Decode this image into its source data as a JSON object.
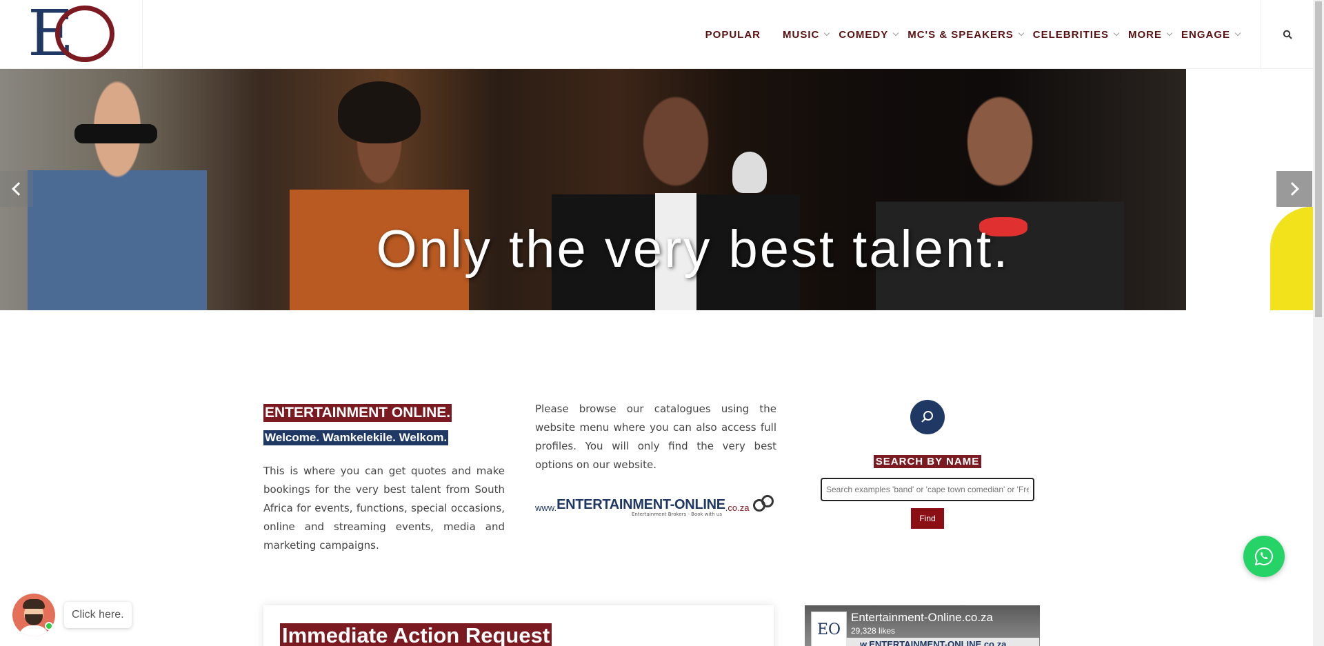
{
  "nav": {
    "items": [
      {
        "label": "POPULAR",
        "dropdown": false
      },
      {
        "label": "MUSIC",
        "dropdown": true
      },
      {
        "label": "COMEDY",
        "dropdown": true
      },
      {
        "label": "MC'S & SPEAKERS",
        "dropdown": true
      },
      {
        "label": "CELEBRITIES",
        "dropdown": true
      },
      {
        "label": "MORE",
        "dropdown": true
      },
      {
        "label": "ENGAGE",
        "dropdown": true
      }
    ],
    "search_icon": "search-icon"
  },
  "hero": {
    "tagline": "Only the very best talent."
  },
  "intro": {
    "title": "ENTERTAINMENT ONLINE.",
    "welcome": "Welcome. Wamkelekile. Welkom.",
    "body": "This is where you can get quotes and make bookings for the very best talent from South Africa for events, functions, special occasions, online and streaming events, media and marketing campaigns."
  },
  "browse": {
    "body": "Please browse our catalogues using the website menu where you can also access full profiles. You will only find the very best options on our website.",
    "wordmark_prefix": "www.",
    "wordmark_main": "ENTERTAINMENT-ONLINE",
    "wordmark_suffix": ".co.za",
    "wordmark_tagline": "Entertainment Brokers - Book with us"
  },
  "search": {
    "title": "SEARCH BY NAME",
    "placeholder": "Search examples 'band' or 'cape town comedian' or 'Fresh'",
    "button": "Find"
  },
  "action": {
    "title": "Immediate Action Request"
  },
  "facebook": {
    "logo_text": "EO",
    "page_name": "Entertainment-Online.co.za",
    "likes": "29,328 likes",
    "banner_text": "w.ENTERTAINMENT-ONLINE.co.za"
  },
  "chat": {
    "bubble": "Click here."
  },
  "colors": {
    "brand_red": "#7b1a20",
    "brand_navy": "#1f3864",
    "whatsapp_green": "#25d366"
  }
}
